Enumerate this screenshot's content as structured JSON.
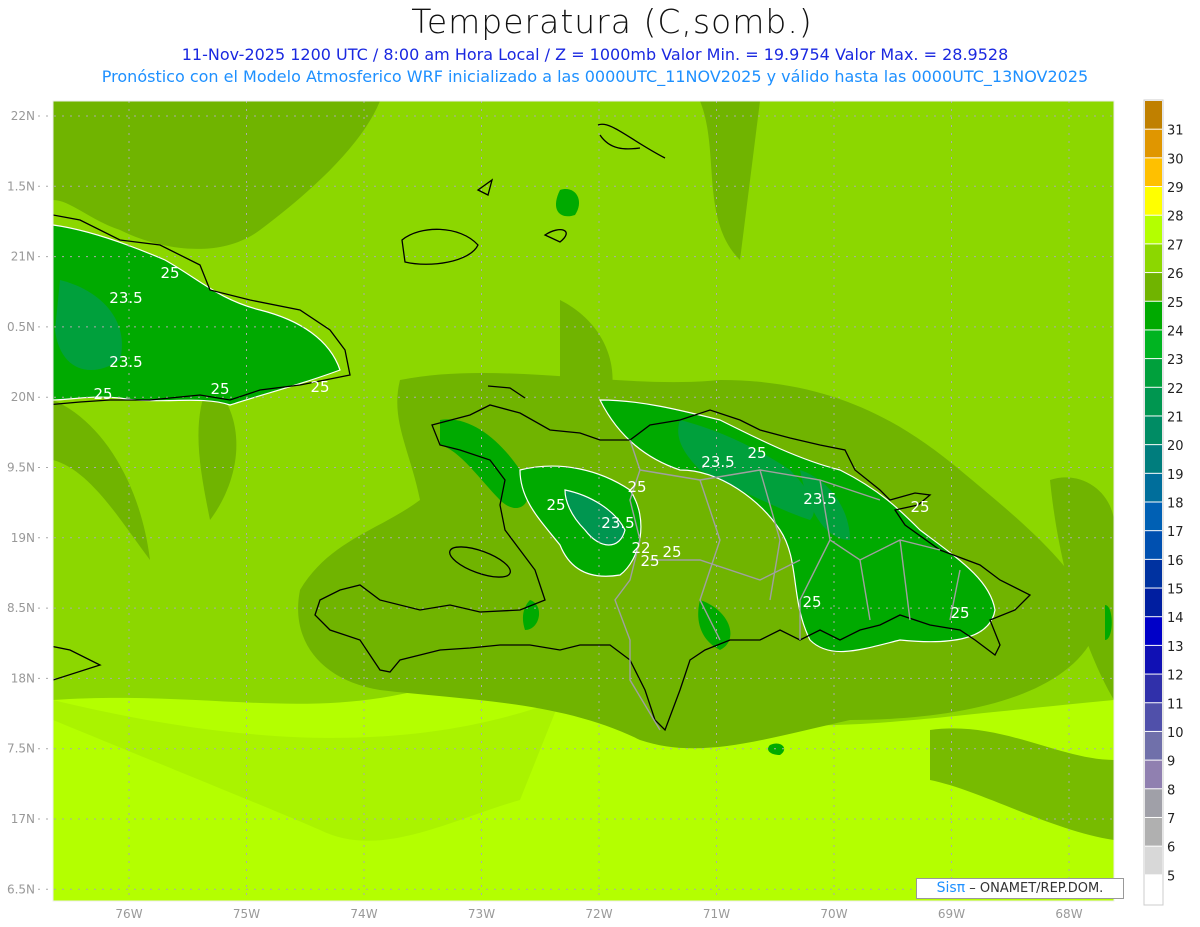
{
  "header": {
    "title": "Temperatura (C,somb.)",
    "subtitle": "11-Nov-2025  1200 UTC / 8:00 am Hora Local / Z = 1000mb   Valor Min. = 19.9754  Valor Max. = 28.9528",
    "model_info": "Pronóstico con el Modelo Atmosferico WRF inicializado a las 0000UTC_11NOV2025 y válido hasta las  0000UTC_13NOV2025"
  },
  "map": {
    "region": "Hispaniola / eastern Cuba / southern Bahamas",
    "lat_labels": [
      "22N",
      "1.5N",
      "21N",
      "0.5N",
      "20N",
      "9.5N",
      "19N",
      "8.5N",
      "18N",
      "7.5N",
      "17N",
      "6.5N"
    ],
    "lon_labels": [
      "76W",
      "75W",
      "74W",
      "73W",
      "72W",
      "71W",
      "70W",
      "69W",
      "68W"
    ],
    "contour_labels": [
      "25",
      "23.5",
      "23.5",
      "25",
      "25",
      "25",
      "25",
      "23.5",
      "25",
      "25",
      "23.5",
      "22",
      "25",
      "25",
      "23.5",
      "25",
      "25",
      "25"
    ],
    "colors": {
      "coastline": "#000000",
      "borders": "#a0a0a0",
      "contour": "#ffffff",
      "gridline": "#aaaaaa"
    }
  },
  "colorbar": {
    "labels": [
      "31",
      "30",
      "29",
      "28",
      "27",
      "26",
      "25",
      "24",
      "23",
      "22",
      "21",
      "20",
      "19",
      "18",
      "17",
      "16",
      "15",
      "14",
      "13",
      "12",
      "11",
      "10",
      "9",
      "8",
      "7",
      "6",
      "5"
    ],
    "colors": [
      "#c08000",
      "#e09600",
      "#ffc000",
      "#ffff00",
      "#b4ff00",
      "#8cd700",
      "#70b400",
      "#00aa00",
      "#00b421",
      "#00a03c",
      "#009650",
      "#008c64",
      "#007d7d",
      "#006e9b",
      "#0060b4",
      "#0050b0",
      "#0032a0",
      "#001ea0",
      "#0000c8",
      "#1010b4",
      "#3030aa",
      "#5050aa",
      "#7070aa",
      "#9080b0",
      "#a0a0a8",
      "#b0b0b0",
      "#d8d8d8",
      "#ffffff"
    ]
  },
  "credit": {
    "logo": "Sisπ",
    "text": "– ONAMET/REP.DOM."
  }
}
